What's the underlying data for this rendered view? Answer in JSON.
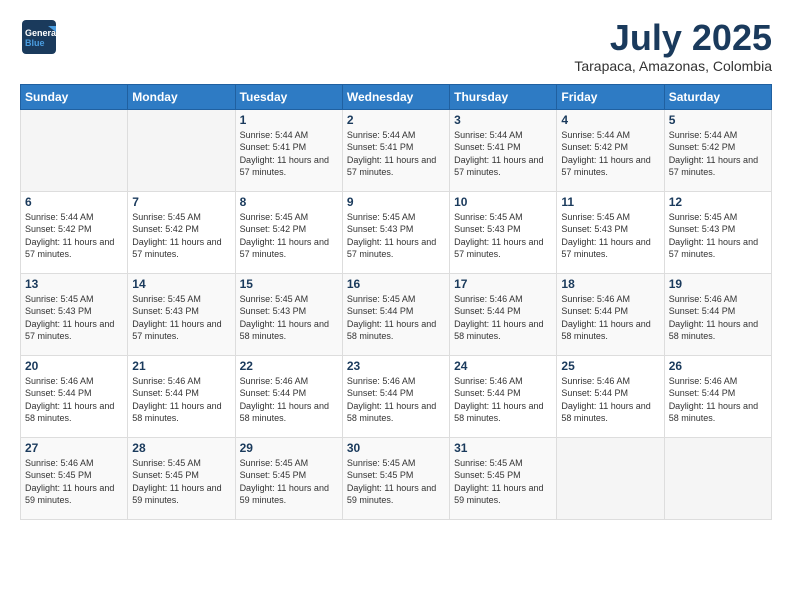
{
  "header": {
    "logo_general": "General",
    "logo_blue": "Blue",
    "month": "July 2025",
    "location": "Tarapaca, Amazonas, Colombia"
  },
  "weekdays": [
    "Sunday",
    "Monday",
    "Tuesday",
    "Wednesday",
    "Thursday",
    "Friday",
    "Saturday"
  ],
  "weeks": [
    [
      {
        "day": "",
        "sunrise": "",
        "sunset": "",
        "daylight": ""
      },
      {
        "day": "",
        "sunrise": "",
        "sunset": "",
        "daylight": ""
      },
      {
        "day": "1",
        "sunrise": "Sunrise: 5:44 AM",
        "sunset": "Sunset: 5:41 PM",
        "daylight": "Daylight: 11 hours and 57 minutes."
      },
      {
        "day": "2",
        "sunrise": "Sunrise: 5:44 AM",
        "sunset": "Sunset: 5:41 PM",
        "daylight": "Daylight: 11 hours and 57 minutes."
      },
      {
        "day": "3",
        "sunrise": "Sunrise: 5:44 AM",
        "sunset": "Sunset: 5:41 PM",
        "daylight": "Daylight: 11 hours and 57 minutes."
      },
      {
        "day": "4",
        "sunrise": "Sunrise: 5:44 AM",
        "sunset": "Sunset: 5:42 PM",
        "daylight": "Daylight: 11 hours and 57 minutes."
      },
      {
        "day": "5",
        "sunrise": "Sunrise: 5:44 AM",
        "sunset": "Sunset: 5:42 PM",
        "daylight": "Daylight: 11 hours and 57 minutes."
      }
    ],
    [
      {
        "day": "6",
        "sunrise": "Sunrise: 5:44 AM",
        "sunset": "Sunset: 5:42 PM",
        "daylight": "Daylight: 11 hours and 57 minutes."
      },
      {
        "day": "7",
        "sunrise": "Sunrise: 5:45 AM",
        "sunset": "Sunset: 5:42 PM",
        "daylight": "Daylight: 11 hours and 57 minutes."
      },
      {
        "day": "8",
        "sunrise": "Sunrise: 5:45 AM",
        "sunset": "Sunset: 5:42 PM",
        "daylight": "Daylight: 11 hours and 57 minutes."
      },
      {
        "day": "9",
        "sunrise": "Sunrise: 5:45 AM",
        "sunset": "Sunset: 5:43 PM",
        "daylight": "Daylight: 11 hours and 57 minutes."
      },
      {
        "day": "10",
        "sunrise": "Sunrise: 5:45 AM",
        "sunset": "Sunset: 5:43 PM",
        "daylight": "Daylight: 11 hours and 57 minutes."
      },
      {
        "day": "11",
        "sunrise": "Sunrise: 5:45 AM",
        "sunset": "Sunset: 5:43 PM",
        "daylight": "Daylight: 11 hours and 57 minutes."
      },
      {
        "day": "12",
        "sunrise": "Sunrise: 5:45 AM",
        "sunset": "Sunset: 5:43 PM",
        "daylight": "Daylight: 11 hours and 57 minutes."
      }
    ],
    [
      {
        "day": "13",
        "sunrise": "Sunrise: 5:45 AM",
        "sunset": "Sunset: 5:43 PM",
        "daylight": "Daylight: 11 hours and 57 minutes."
      },
      {
        "day": "14",
        "sunrise": "Sunrise: 5:45 AM",
        "sunset": "Sunset: 5:43 PM",
        "daylight": "Daylight: 11 hours and 57 minutes."
      },
      {
        "day": "15",
        "sunrise": "Sunrise: 5:45 AM",
        "sunset": "Sunset: 5:43 PM",
        "daylight": "Daylight: 11 hours and 58 minutes."
      },
      {
        "day": "16",
        "sunrise": "Sunrise: 5:45 AM",
        "sunset": "Sunset: 5:44 PM",
        "daylight": "Daylight: 11 hours and 58 minutes."
      },
      {
        "day": "17",
        "sunrise": "Sunrise: 5:46 AM",
        "sunset": "Sunset: 5:44 PM",
        "daylight": "Daylight: 11 hours and 58 minutes."
      },
      {
        "day": "18",
        "sunrise": "Sunrise: 5:46 AM",
        "sunset": "Sunset: 5:44 PM",
        "daylight": "Daylight: 11 hours and 58 minutes."
      },
      {
        "day": "19",
        "sunrise": "Sunrise: 5:46 AM",
        "sunset": "Sunset: 5:44 PM",
        "daylight": "Daylight: 11 hours and 58 minutes."
      }
    ],
    [
      {
        "day": "20",
        "sunrise": "Sunrise: 5:46 AM",
        "sunset": "Sunset: 5:44 PM",
        "daylight": "Daylight: 11 hours and 58 minutes."
      },
      {
        "day": "21",
        "sunrise": "Sunrise: 5:46 AM",
        "sunset": "Sunset: 5:44 PM",
        "daylight": "Daylight: 11 hours and 58 minutes."
      },
      {
        "day": "22",
        "sunrise": "Sunrise: 5:46 AM",
        "sunset": "Sunset: 5:44 PM",
        "daylight": "Daylight: 11 hours and 58 minutes."
      },
      {
        "day": "23",
        "sunrise": "Sunrise: 5:46 AM",
        "sunset": "Sunset: 5:44 PM",
        "daylight": "Daylight: 11 hours and 58 minutes."
      },
      {
        "day": "24",
        "sunrise": "Sunrise: 5:46 AM",
        "sunset": "Sunset: 5:44 PM",
        "daylight": "Daylight: 11 hours and 58 minutes."
      },
      {
        "day": "25",
        "sunrise": "Sunrise: 5:46 AM",
        "sunset": "Sunset: 5:44 PM",
        "daylight": "Daylight: 11 hours and 58 minutes."
      },
      {
        "day": "26",
        "sunrise": "Sunrise: 5:46 AM",
        "sunset": "Sunset: 5:44 PM",
        "daylight": "Daylight: 11 hours and 58 minutes."
      }
    ],
    [
      {
        "day": "27",
        "sunrise": "Sunrise: 5:46 AM",
        "sunset": "Sunset: 5:45 PM",
        "daylight": "Daylight: 11 hours and 59 minutes."
      },
      {
        "day": "28",
        "sunrise": "Sunrise: 5:45 AM",
        "sunset": "Sunset: 5:45 PM",
        "daylight": "Daylight: 11 hours and 59 minutes."
      },
      {
        "day": "29",
        "sunrise": "Sunrise: 5:45 AM",
        "sunset": "Sunset: 5:45 PM",
        "daylight": "Daylight: 11 hours and 59 minutes."
      },
      {
        "day": "30",
        "sunrise": "Sunrise: 5:45 AM",
        "sunset": "Sunset: 5:45 PM",
        "daylight": "Daylight: 11 hours and 59 minutes."
      },
      {
        "day": "31",
        "sunrise": "Sunrise: 5:45 AM",
        "sunset": "Sunset: 5:45 PM",
        "daylight": "Daylight: 11 hours and 59 minutes."
      },
      {
        "day": "",
        "sunrise": "",
        "sunset": "",
        "daylight": ""
      },
      {
        "day": "",
        "sunrise": "",
        "sunset": "",
        "daylight": ""
      }
    ]
  ]
}
